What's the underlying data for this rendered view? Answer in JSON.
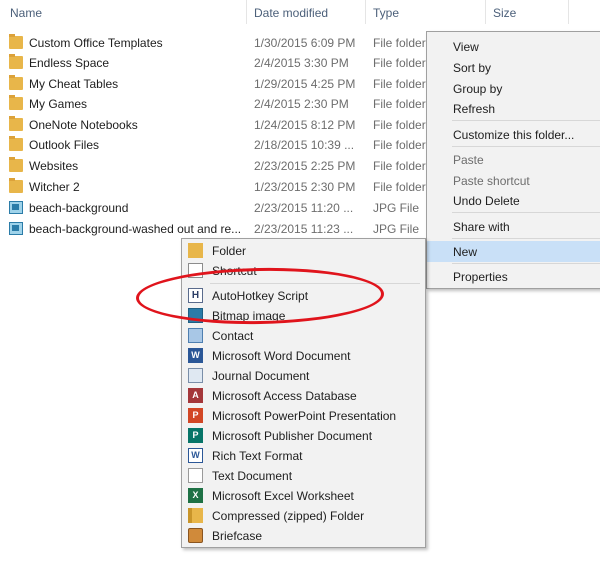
{
  "columns": {
    "name": "Name",
    "date": "Date modified",
    "type": "Type",
    "size": "Size"
  },
  "files": [
    {
      "name": "Custom Office Templates",
      "date": "1/30/2015 6:09 PM",
      "type": "File folder",
      "icon": "folder-icon"
    },
    {
      "name": "Endless Space",
      "date": "2/4/2015 3:30 PM",
      "type": "File folder",
      "icon": "folder-icon"
    },
    {
      "name": "My Cheat Tables",
      "date": "1/29/2015 4:25 PM",
      "type": "File folder",
      "icon": "folder-icon"
    },
    {
      "name": "My Games",
      "date": "2/4/2015 2:30 PM",
      "type": "File folder",
      "icon": "folder-icon"
    },
    {
      "name": "OneNote Notebooks",
      "date": "1/24/2015 8:12 PM",
      "type": "File folder",
      "icon": "folder-icon"
    },
    {
      "name": "Outlook Files",
      "date": "2/18/2015 10:39 ...",
      "type": "File folder",
      "icon": "folder-icon"
    },
    {
      "name": "Websites",
      "date": "2/23/2015 2:25 PM",
      "type": "File folder",
      "icon": "folder-icon"
    },
    {
      "name": "Witcher 2",
      "date": "1/23/2015 2:30 PM",
      "type": "File folder",
      "icon": "folder-icon"
    },
    {
      "name": "beach-background",
      "date": "2/23/2015 11:20 ...",
      "type": "JPG File",
      "icon": "image-icon"
    },
    {
      "name": "beach-background-washed out and re...",
      "date": "2/23/2015 11:23 ...",
      "type": "JPG File",
      "icon": "image-icon"
    }
  ],
  "context_menu": {
    "view": "View",
    "sort_by": "Sort by",
    "group_by": "Group by",
    "refresh": "Refresh",
    "customize": "Customize this folder...",
    "paste": "Paste",
    "paste_shortcut": "Paste shortcut",
    "undo_delete": "Undo Delete",
    "share_with": "Share with",
    "new": "New",
    "properties": "Properties"
  },
  "new_submenu": {
    "folder": "Folder",
    "shortcut": "Shortcut",
    "autohotkey": "AutoHotkey Script",
    "bitmap": "Bitmap image",
    "contact": "Contact",
    "word": "Microsoft Word Document",
    "journal": "Journal Document",
    "access": "Microsoft Access Database",
    "powerpoint": "Microsoft PowerPoint Presentation",
    "publisher": "Microsoft Publisher Document",
    "rtf": "Rich Text Format",
    "text": "Text Document",
    "excel": "Microsoft Excel Worksheet",
    "zip": "Compressed (zipped) Folder",
    "briefcase": "Briefcase"
  },
  "colors": {
    "highlight": "#c9e0f7",
    "annotation": "#e0141c",
    "header_text": "#4c607a"
  }
}
